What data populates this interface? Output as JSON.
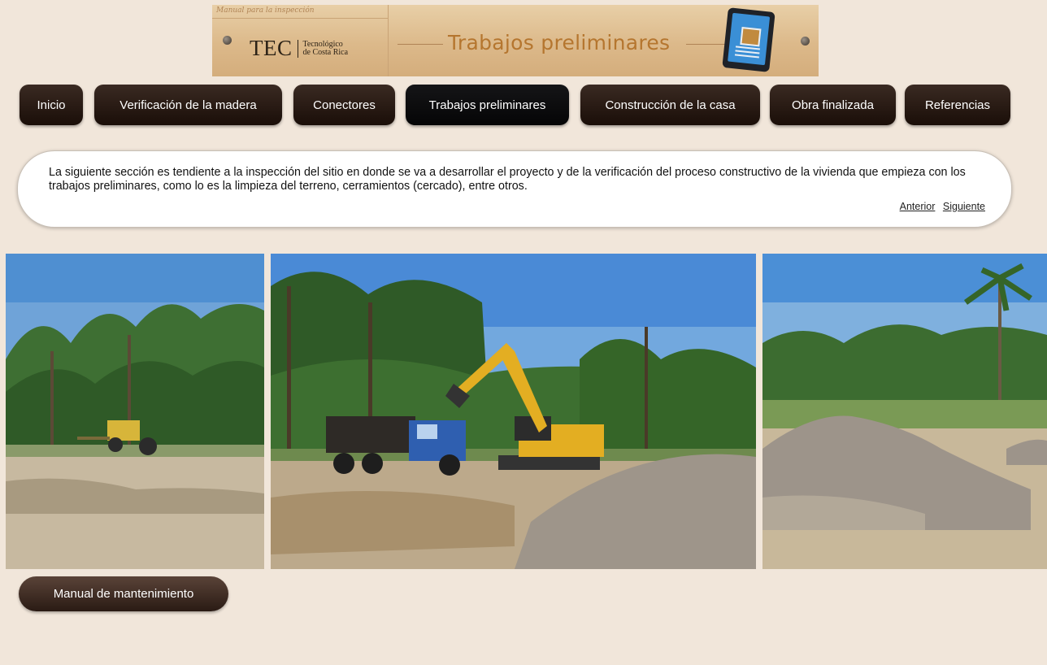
{
  "banner": {
    "manual_label": "Manual para la inspección",
    "logo_text": "TEC",
    "logo_sub_line1": "Tecnológico",
    "logo_sub_line2": "de Costa Rica",
    "title": "Trabajos preliminares"
  },
  "nav": {
    "items": [
      {
        "label": "Inicio"
      },
      {
        "label": "Verificación de la madera"
      },
      {
        "label": "Conectores"
      },
      {
        "label": "Trabajos preliminares"
      },
      {
        "label": "Construcción de la casa"
      },
      {
        "label": "Obra finalizada"
      },
      {
        "label": "Referencias"
      }
    ],
    "active": "Trabajos preliminares"
  },
  "intro": {
    "text": "La siguiente sección es tendiente a la inspección del sitio en donde se va a desarrollar el proyecto y de la verificación del proceso constructivo de la vivienda que empieza con los trabajos preliminares, como lo es la limpieza del terreno, cerramientos (cercado), entre otros.",
    "prev_label": "Anterior",
    "next_label": "Siguiente"
  },
  "photos": [
    {
      "icon": "construction-site-photo-left"
    },
    {
      "icon": "excavator-truck-photo"
    },
    {
      "icon": "gravel-pile-photo"
    }
  ],
  "footer": {
    "maintenance_label": "Manual de mantenimiento"
  },
  "colors": {
    "background": "#f1e6da",
    "nav_button": "#2a1b14",
    "title_accent": "#b5762f"
  }
}
